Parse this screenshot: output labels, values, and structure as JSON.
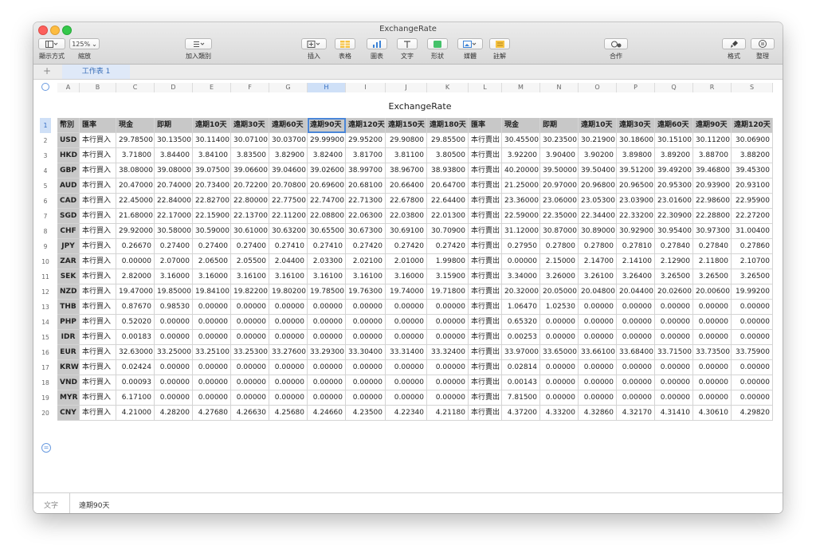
{
  "window": {
    "title": "ExchangeRate"
  },
  "toolbar": {
    "view_label": "顯示方式",
    "zoom_value": "125%",
    "zoom_label": "縮放",
    "category_label": "加入類別",
    "insert_label": "插入",
    "table_label": "表格",
    "chart_label": "圖表",
    "text_label": "文字",
    "shape_label": "形狀",
    "media_label": "媒體",
    "comment_label": "註解",
    "collaborate_label": "合作",
    "format_label": "格式",
    "organize_label": "整理"
  },
  "sheet_tabs": {
    "add": "+",
    "tab1": "工作表 1"
  },
  "table": {
    "title": "ExchangeRate",
    "column_letters": [
      "A",
      "B",
      "C",
      "D",
      "E",
      "F",
      "G",
      "H",
      "I",
      "J",
      "K",
      "L",
      "M",
      "N",
      "O",
      "P",
      "Q",
      "R",
      "S"
    ],
    "headers": [
      "幣別",
      "匯率",
      "現金",
      "即期",
      "遠期10天",
      "遠期30天",
      "遠期60天",
      "遠期90天",
      "遠期120天",
      "遠期150天",
      "遠期180天",
      "匯率",
      "現金",
      "即期",
      "遠期10天",
      "遠期30天",
      "遠期60天",
      "遠期90天",
      "遠期120天"
    ],
    "rows": [
      [
        "USD",
        "本行買入",
        "29.78500",
        "30.13500",
        "30.11400",
        "30.07100",
        "30.03700",
        "29.99900",
        "29.95200",
        "29.90800",
        "29.85500",
        "本行賣出",
        "30.45500",
        "30.23500",
        "30.21900",
        "30.18600",
        "30.15100",
        "30.11200",
        "30.06900"
      ],
      [
        "HKD",
        "本行買入",
        "3.71800",
        "3.84400",
        "3.84100",
        "3.83500",
        "3.82900",
        "3.82400",
        "3.81700",
        "3.81100",
        "3.80500",
        "本行賣出",
        "3.92200",
        "3.90400",
        "3.90200",
        "3.89800",
        "3.89200",
        "3.88700",
        "3.88200"
      ],
      [
        "GBP",
        "本行買入",
        "38.08000",
        "39.08000",
        "39.07500",
        "39.06600",
        "39.04600",
        "39.02600",
        "38.99700",
        "38.96700",
        "38.93800",
        "本行賣出",
        "40.20000",
        "39.50000",
        "39.50400",
        "39.51200",
        "39.49200",
        "39.46800",
        "39.45300"
      ],
      [
        "AUD",
        "本行買入",
        "20.47000",
        "20.74000",
        "20.73400",
        "20.72200",
        "20.70800",
        "20.69600",
        "20.68100",
        "20.66400",
        "20.64700",
        "本行賣出",
        "21.25000",
        "20.97000",
        "20.96800",
        "20.96500",
        "20.95300",
        "20.93900",
        "20.93100"
      ],
      [
        "CAD",
        "本行買入",
        "22.45000",
        "22.84000",
        "22.82700",
        "22.80000",
        "22.77500",
        "22.74700",
        "22.71300",
        "22.67800",
        "22.64400",
        "本行賣出",
        "23.36000",
        "23.06000",
        "23.05300",
        "23.03900",
        "23.01600",
        "22.98600",
        "22.95900"
      ],
      [
        "SGD",
        "本行買入",
        "21.68000",
        "22.17000",
        "22.15900",
        "22.13700",
        "22.11200",
        "22.08800",
        "22.06300",
        "22.03800",
        "22.01300",
        "本行賣出",
        "22.59000",
        "22.35000",
        "22.34400",
        "22.33200",
        "22.30900",
        "22.28800",
        "22.27200"
      ],
      [
        "CHF",
        "本行買入",
        "29.92000",
        "30.58000",
        "30.59000",
        "30.61000",
        "30.63200",
        "30.65500",
        "30.67300",
        "30.69100",
        "30.70900",
        "本行賣出",
        "31.12000",
        "30.87000",
        "30.89000",
        "30.92900",
        "30.95400",
        "30.97300",
        "31.00400"
      ],
      [
        "JPY",
        "本行買入",
        "0.26670",
        "0.27400",
        "0.27400",
        "0.27400",
        "0.27410",
        "0.27410",
        "0.27420",
        "0.27420",
        "0.27420",
        "本行賣出",
        "0.27950",
        "0.27800",
        "0.27800",
        "0.27810",
        "0.27840",
        "0.27840",
        "0.27860"
      ],
      [
        "ZAR",
        "本行買入",
        "0.00000",
        "2.07000",
        "2.06500",
        "2.05500",
        "2.04400",
        "2.03300",
        "2.02100",
        "2.01000",
        "1.99800",
        "本行賣出",
        "0.00000",
        "2.15000",
        "2.14700",
        "2.14100",
        "2.12900",
        "2.11800",
        "2.10700"
      ],
      [
        "SEK",
        "本行買入",
        "2.82000",
        "3.16000",
        "3.16000",
        "3.16100",
        "3.16100",
        "3.16100",
        "3.16100",
        "3.16000",
        "3.15900",
        "本行賣出",
        "3.34000",
        "3.26000",
        "3.26100",
        "3.26400",
        "3.26500",
        "3.26500",
        "3.26500"
      ],
      [
        "NZD",
        "本行買入",
        "19.47000",
        "19.85000",
        "19.84100",
        "19.82200",
        "19.80200",
        "19.78500",
        "19.76300",
        "19.74000",
        "19.71800",
        "本行賣出",
        "20.32000",
        "20.05000",
        "20.04800",
        "20.04400",
        "20.02600",
        "20.00600",
        "19.99200"
      ],
      [
        "THB",
        "本行買入",
        "0.87670",
        "0.98530",
        "0.00000",
        "0.00000",
        "0.00000",
        "0.00000",
        "0.00000",
        "0.00000",
        "0.00000",
        "本行賣出",
        "1.06470",
        "1.02530",
        "0.00000",
        "0.00000",
        "0.00000",
        "0.00000",
        "0.00000"
      ],
      [
        "PHP",
        "本行買入",
        "0.52020",
        "0.00000",
        "0.00000",
        "0.00000",
        "0.00000",
        "0.00000",
        "0.00000",
        "0.00000",
        "0.00000",
        "本行賣出",
        "0.65320",
        "0.00000",
        "0.00000",
        "0.00000",
        "0.00000",
        "0.00000",
        "0.00000"
      ],
      [
        "IDR",
        "本行買入",
        "0.00183",
        "0.00000",
        "0.00000",
        "0.00000",
        "0.00000",
        "0.00000",
        "0.00000",
        "0.00000",
        "0.00000",
        "本行賣出",
        "0.00253",
        "0.00000",
        "0.00000",
        "0.00000",
        "0.00000",
        "0.00000",
        "0.00000"
      ],
      [
        "EUR",
        "本行買入",
        "32.63000",
        "33.25000",
        "33.25100",
        "33.25300",
        "33.27600",
        "33.29300",
        "33.30400",
        "33.31400",
        "33.32400",
        "本行賣出",
        "33.97000",
        "33.65000",
        "33.66100",
        "33.68400",
        "33.71500",
        "33.73500",
        "33.75900"
      ],
      [
        "KRW",
        "本行買入",
        "0.02424",
        "0.00000",
        "0.00000",
        "0.00000",
        "0.00000",
        "0.00000",
        "0.00000",
        "0.00000",
        "0.00000",
        "本行賣出",
        "0.02814",
        "0.00000",
        "0.00000",
        "0.00000",
        "0.00000",
        "0.00000",
        "0.00000"
      ],
      [
        "VND",
        "本行買入",
        "0.00093",
        "0.00000",
        "0.00000",
        "0.00000",
        "0.00000",
        "0.00000",
        "0.00000",
        "0.00000",
        "0.00000",
        "本行賣出",
        "0.00143",
        "0.00000",
        "0.00000",
        "0.00000",
        "0.00000",
        "0.00000",
        "0.00000"
      ],
      [
        "MYR",
        "本行買入",
        "6.17100",
        "0.00000",
        "0.00000",
        "0.00000",
        "0.00000",
        "0.00000",
        "0.00000",
        "0.00000",
        "0.00000",
        "本行賣出",
        "7.81500",
        "0.00000",
        "0.00000",
        "0.00000",
        "0.00000",
        "0.00000",
        "0.00000"
      ],
      [
        "CNY",
        "本行買入",
        "4.21000",
        "4.28200",
        "4.27680",
        "4.26630",
        "4.25680",
        "4.24660",
        "4.23500",
        "4.22340",
        "4.21180",
        "本行賣出",
        "4.37200",
        "4.33200",
        "4.32860",
        "4.32170",
        "4.31410",
        "4.30610",
        "4.29820"
      ]
    ],
    "selected_column": "H"
  },
  "status": {
    "label": "文字",
    "value": "遠期90天"
  }
}
